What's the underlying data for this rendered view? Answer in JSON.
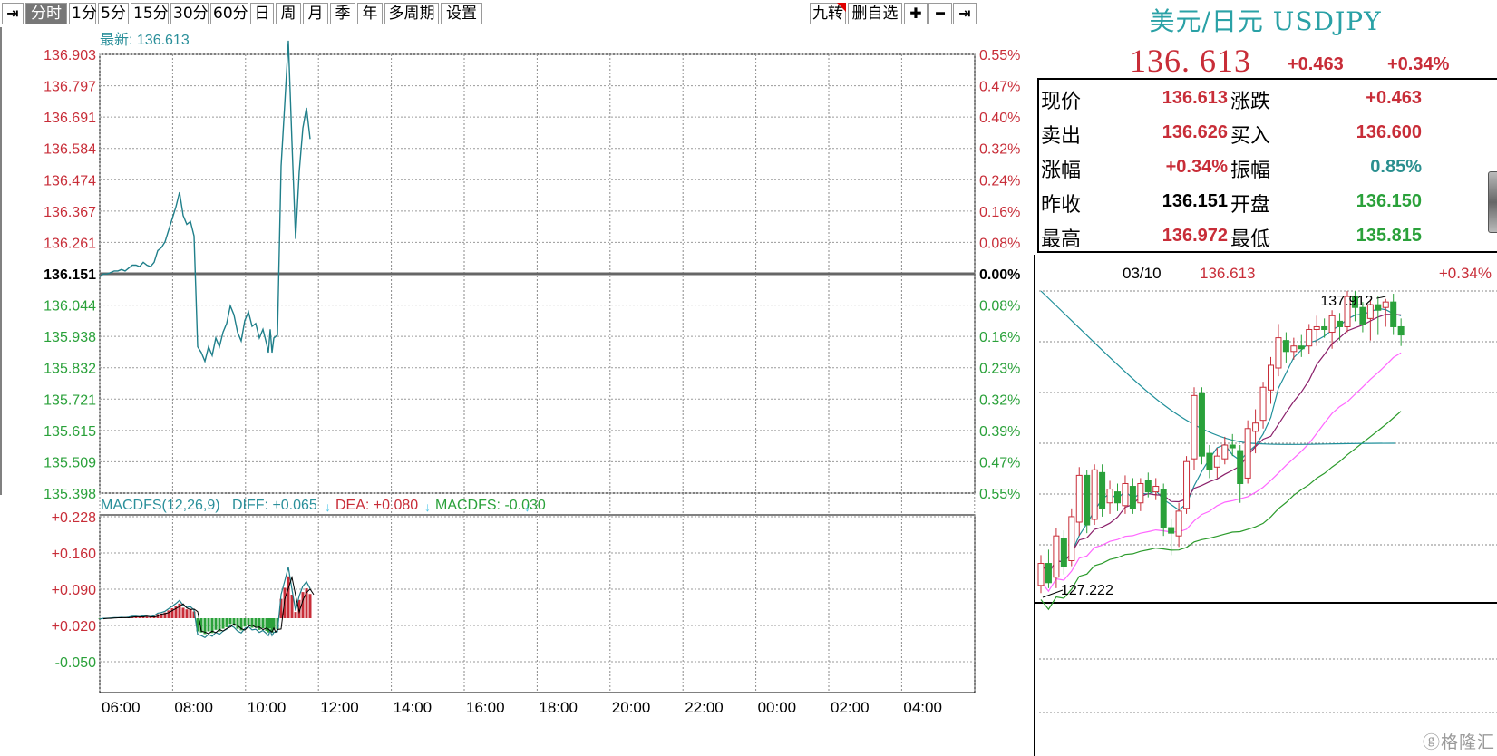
{
  "toolbar": {
    "buttons": [
      "分时",
      "1分",
      "5分",
      "15分",
      "30分",
      "60分",
      "日",
      "周",
      "月",
      "季",
      "年",
      "多周期",
      "设置"
    ],
    "active": "分时",
    "right_buttons": [
      "九转",
      "删自选"
    ],
    "icons": [
      "arrow-right-to-bar-icon",
      "plus-icon",
      "minus-icon",
      "arrow-right-to-bar-icon"
    ]
  },
  "quote": {
    "title": "美元/日元 USDJPY",
    "price": "136. 613",
    "change": "+0.463",
    "change_pct": "+0.34%",
    "rows": [
      {
        "l1": "现价",
        "v1": "136.613",
        "c1": "#c82d38",
        "l2": "涨跌",
        "v2": "+0.463",
        "c2": "#c82d38"
      },
      {
        "l1": "卖出",
        "v1": "136.626",
        "c1": "#c82d38",
        "l2": "买入",
        "v2": "136.600",
        "c2": "#c82d38"
      },
      {
        "l1": "涨幅",
        "v1": "+0.34%",
        "c1": "#c82d38",
        "l2": "振幅",
        "v2": "0.85%",
        "c2": "#2a8f8f"
      },
      {
        "l1": "昨收",
        "v1": "136.151",
        "c1": "#000000",
        "l2": "开盘",
        "v2": "136.150",
        "c2": "#2aa13a"
      },
      {
        "l1": "最高",
        "v1": "136.972",
        "c1": "#c82d38",
        "l2": "最低",
        "v2": "135.815",
        "c2": "#2aa13a"
      }
    ]
  },
  "chart_data": [
    {
      "type": "line",
      "title": "最新: 136.613",
      "prev_close": 136.151,
      "ylim": [
        135.398,
        136.903
      ],
      "y_ticks_left": [
        "136.903",
        "136.797",
        "136.691",
        "136.584",
        "136.474",
        "136.367",
        "136.261",
        "136.151",
        "136.044",
        "135.938",
        "135.832",
        "135.721",
        "135.615",
        "135.509",
        "135.398"
      ],
      "y_ticks_right": [
        "0.55%",
        "0.47%",
        "0.40%",
        "0.32%",
        "0.24%",
        "0.16%",
        "0.08%",
        "0.00%",
        "0.08%",
        "0.16%",
        "0.23%",
        "0.32%",
        "0.39%",
        "0.47%",
        "0.55%"
      ],
      "x_ticks": [
        "06:00",
        "08:00",
        "10:00",
        "12:00",
        "14:00",
        "16:00",
        "18:00",
        "20:00",
        "22:00",
        "00:00",
        "02:00",
        "04:00"
      ],
      "series": [
        {
          "x": [
            0,
            4,
            8,
            12,
            16,
            20,
            24,
            28,
            32,
            36,
            40,
            44,
            48,
            52,
            56,
            60,
            64,
            68,
            72,
            76,
            80,
            84,
            88,
            92,
            96,
            100,
            104,
            108,
            112,
            116,
            120,
            124,
            128,
            132,
            136,
            140,
            144,
            148,
            152,
            156,
            160,
            164,
            168,
            172,
            176,
            180,
            184,
            186,
            188,
            190,
            192,
            196,
            200,
            204,
            208,
            212,
            216,
            220,
            224,
            228,
            232,
            236,
            240,
            244,
            248,
            252,
            256,
            260,
            264,
            268,
            272,
            276,
            280,
            284,
            288,
            292,
            296,
            300,
            304,
            308,
            312,
            316
          ],
          "values": [
            136.14,
            136.15,
            136.15,
            136.155,
            136.16,
            136.16,
            136.165,
            136.16,
            136.17,
            136.18,
            136.18,
            136.175,
            136.19,
            136.18,
            136.175,
            136.19,
            136.23,
            136.24,
            136.26,
            136.3,
            136.34,
            136.38,
            136.43,
            136.35,
            136.32,
            136.33,
            136.28,
            135.9,
            135.88,
            135.85,
            135.9,
            135.87,
            135.93,
            135.9,
            135.95,
            135.98,
            136.04,
            136.01,
            135.95,
            135.92,
            135.99,
            136.02,
            135.97,
            135.98,
            135.93,
            135.96,
            135.91,
            135.88,
            135.96,
            135.88,
            135.93,
            135.94,
            136.52,
            136.73,
            136.95,
            136.6,
            136.27,
            136.5,
            136.65,
            136.72,
            136.613,
            136.613,
            136.613,
            136.613,
            136.613,
            136.613,
            136.613,
            136.613,
            136.613,
            136.613,
            136.613,
            136.613,
            136.613,
            136.613,
            136.613,
            136.613,
            136.613,
            136.613,
            136.613,
            136.613,
            136.613,
            136.613
          ]
        }
      ]
    },
    {
      "type": "bar",
      "title": "MACDFS(12,26,9)",
      "legend": [
        {
          "name": "DIFF",
          "value": "+0.065",
          "color": "#2a8f9a"
        },
        {
          "name": "DEA",
          "value": "+0.080",
          "color": "#c82d38"
        },
        {
          "name": "MACDFS",
          "value": "-0.030",
          "color": "#2aa13a"
        }
      ],
      "ylim": [
        -0.1,
        0.228
      ],
      "y_ticks": [
        "+0.228",
        "+0.160",
        "+0.090",
        "+0.020",
        "-0.050"
      ],
      "x_ticks": [
        "06:00",
        "08:00",
        "10:00",
        "12:00",
        "14:00",
        "16:00",
        "18:00",
        "20:00",
        "22:00",
        "00:00",
        "02:00",
        "04:00"
      ]
    },
    {
      "type": "candlestick",
      "header": {
        "date": "03/10",
        "value": "136.613",
        "pct": "+0.34%"
      },
      "annotations": {
        "high": "137.912",
        "low": "127.222"
      },
      "ylim": [
        127.0,
        138.2
      ],
      "candles": [
        [
          127.5,
          128.3,
          127.222,
          128.6
        ],
        [
          128.3,
          127.6,
          127.4,
          128.8
        ],
        [
          127.8,
          129.3,
          127.4,
          129.6
        ],
        [
          129.2,
          128.2,
          127.9,
          129.5
        ],
        [
          128.4,
          130.0,
          128.2,
          130.3
        ],
        [
          129.8,
          131.5,
          129.3,
          131.8
        ],
        [
          131.5,
          129.7,
          129.4,
          131.7
        ],
        [
          129.9,
          131.7,
          129.7,
          131.9
        ],
        [
          131.6,
          130.3,
          130.0,
          131.9
        ],
        [
          130.5,
          131.0,
          130.1,
          131.3
        ],
        [
          130.9,
          130.5,
          130.2,
          131.2
        ],
        [
          130.4,
          131.2,
          130.1,
          131.5
        ],
        [
          131.1,
          130.3,
          130.1,
          131.4
        ],
        [
          130.5,
          131.2,
          130.2,
          131.4
        ],
        [
          131.3,
          130.9,
          130.7,
          131.6
        ],
        [
          130.9,
          131.1,
          130.6,
          131.4
        ],
        [
          131.0,
          129.6,
          129.3,
          131.2
        ],
        [
          129.6,
          129.4,
          128.6,
          129.9
        ],
        [
          129.3,
          130.2,
          128.9,
          130.5
        ],
        [
          130.3,
          132.0,
          130.1,
          132.2
        ],
        [
          132.1,
          134.4,
          131.7,
          134.7
        ],
        [
          134.5,
          132.2,
          131.9,
          134.7
        ],
        [
          132.3,
          131.7,
          131.4,
          132.6
        ],
        [
          131.8,
          132.2,
          131.4,
          132.5
        ],
        [
          132.1,
          132.6,
          131.9,
          132.9
        ],
        [
          132.6,
          132.5,
          132.2,
          133.0
        ],
        [
          132.4,
          131.2,
          130.5,
          132.6
        ],
        [
          131.4,
          133.2,
          131.2,
          133.5
        ],
        [
          133.1,
          133.4,
          132.3,
          133.9
        ],
        [
          133.5,
          134.7,
          133.2,
          134.9
        ],
        [
          134.6,
          135.5,
          134.1,
          135.8
        ],
        [
          135.4,
          136.5,
          135.1,
          137.0
        ],
        [
          136.4,
          136.0,
          135.6,
          136.7
        ],
        [
          136.0,
          136.2,
          135.7,
          136.5
        ],
        [
          136.2,
          136.1,
          135.8,
          136.6
        ],
        [
          136.2,
          136.8,
          135.9,
          137.0
        ],
        [
          136.8,
          136.9,
          136.2,
          137.3
        ],
        [
          136.9,
          136.8,
          136.5,
          137.2
        ],
        [
          136.7,
          137.3,
          136.1,
          137.5
        ],
        [
          137.1,
          136.9,
          136.4,
          137.4
        ],
        [
          136.9,
          138.0,
          136.7,
          138.2
        ],
        [
          138.0,
          137.6,
          137.1,
          138.2
        ],
        [
          137.6,
          137.0,
          136.7,
          137.8
        ],
        [
          137.2,
          137.7,
          136.4,
          137.9
        ],
        [
          137.7,
          137.5,
          136.6,
          138.0
        ],
        [
          137.6,
          137.8,
          136.9,
          137.912
        ],
        [
          137.8,
          136.9,
          136.6,
          138.1
        ],
        [
          136.9,
          136.6,
          136.2,
          137.2
        ]
      ]
    }
  ]
}
